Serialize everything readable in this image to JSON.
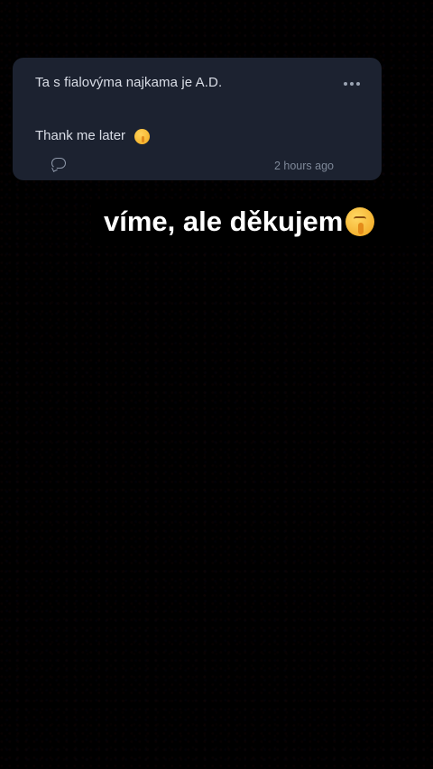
{
  "comment": {
    "line1": "Ta s fialovýma najkama je A.D.",
    "line2": "Thank me later",
    "timestamp": "2 hours ago",
    "icons": {
      "reply": "comment-icon",
      "more": "more-horizontal-icon",
      "emoji": "shushing-face-icon"
    }
  },
  "story": {
    "text": "víme, ale děkujem",
    "emoji": "shushing-face-icon"
  },
  "colors": {
    "background": "#000000",
    "card": "#1c2230",
    "card_text": "#d9dde6",
    "muted": "#7e8898",
    "story_text": "#ffffff"
  }
}
